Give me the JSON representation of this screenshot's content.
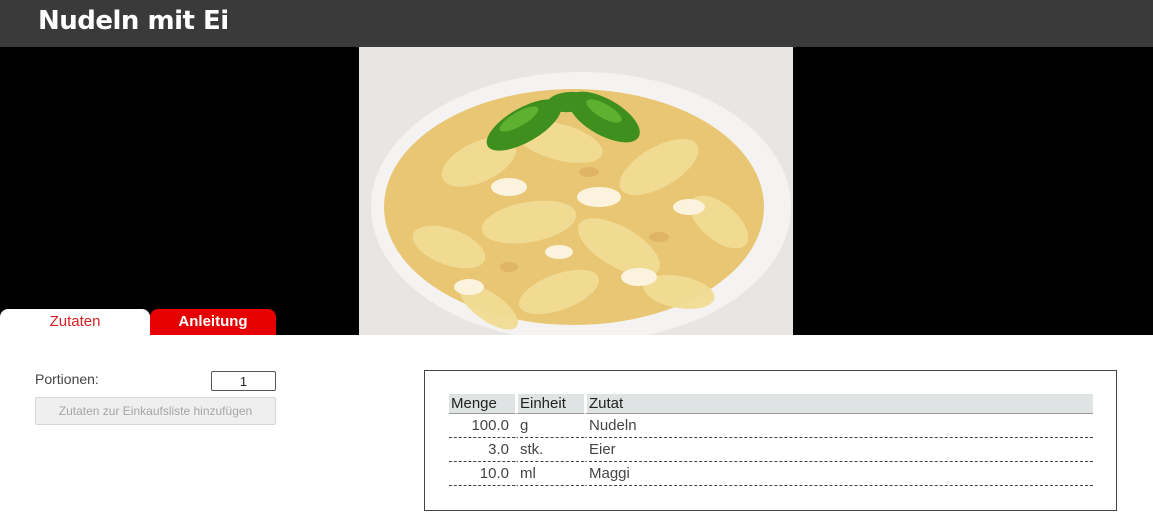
{
  "header": {
    "title": "Nudeln mit Ei"
  },
  "hero": {
    "image": "pasta-with-egg-and-basil-photo"
  },
  "tabs": [
    {
      "label": "Zutaten",
      "active": true
    },
    {
      "label": "Anleitung",
      "active": false
    }
  ],
  "portions": {
    "label": "Portionen:",
    "value": "1"
  },
  "add_button": {
    "label": "Zutaten zur Einkaufsliste hinzufügen"
  },
  "ingredients": {
    "columns": [
      "Menge",
      "Einheit",
      "Zutat"
    ],
    "rows": [
      {
        "menge": "100.0",
        "einheit": "g",
        "zutat": "Nudeln"
      },
      {
        "menge": "3.0",
        "einheit": "stk.",
        "zutat": "Eier"
      },
      {
        "menge": "10.0",
        "einheit": "ml",
        "zutat": "Maggi"
      }
    ]
  },
  "colors": {
    "header_bg": "#3a3a3a",
    "accent_red": "#e60000",
    "active_tab_text": "#d81e1e"
  }
}
